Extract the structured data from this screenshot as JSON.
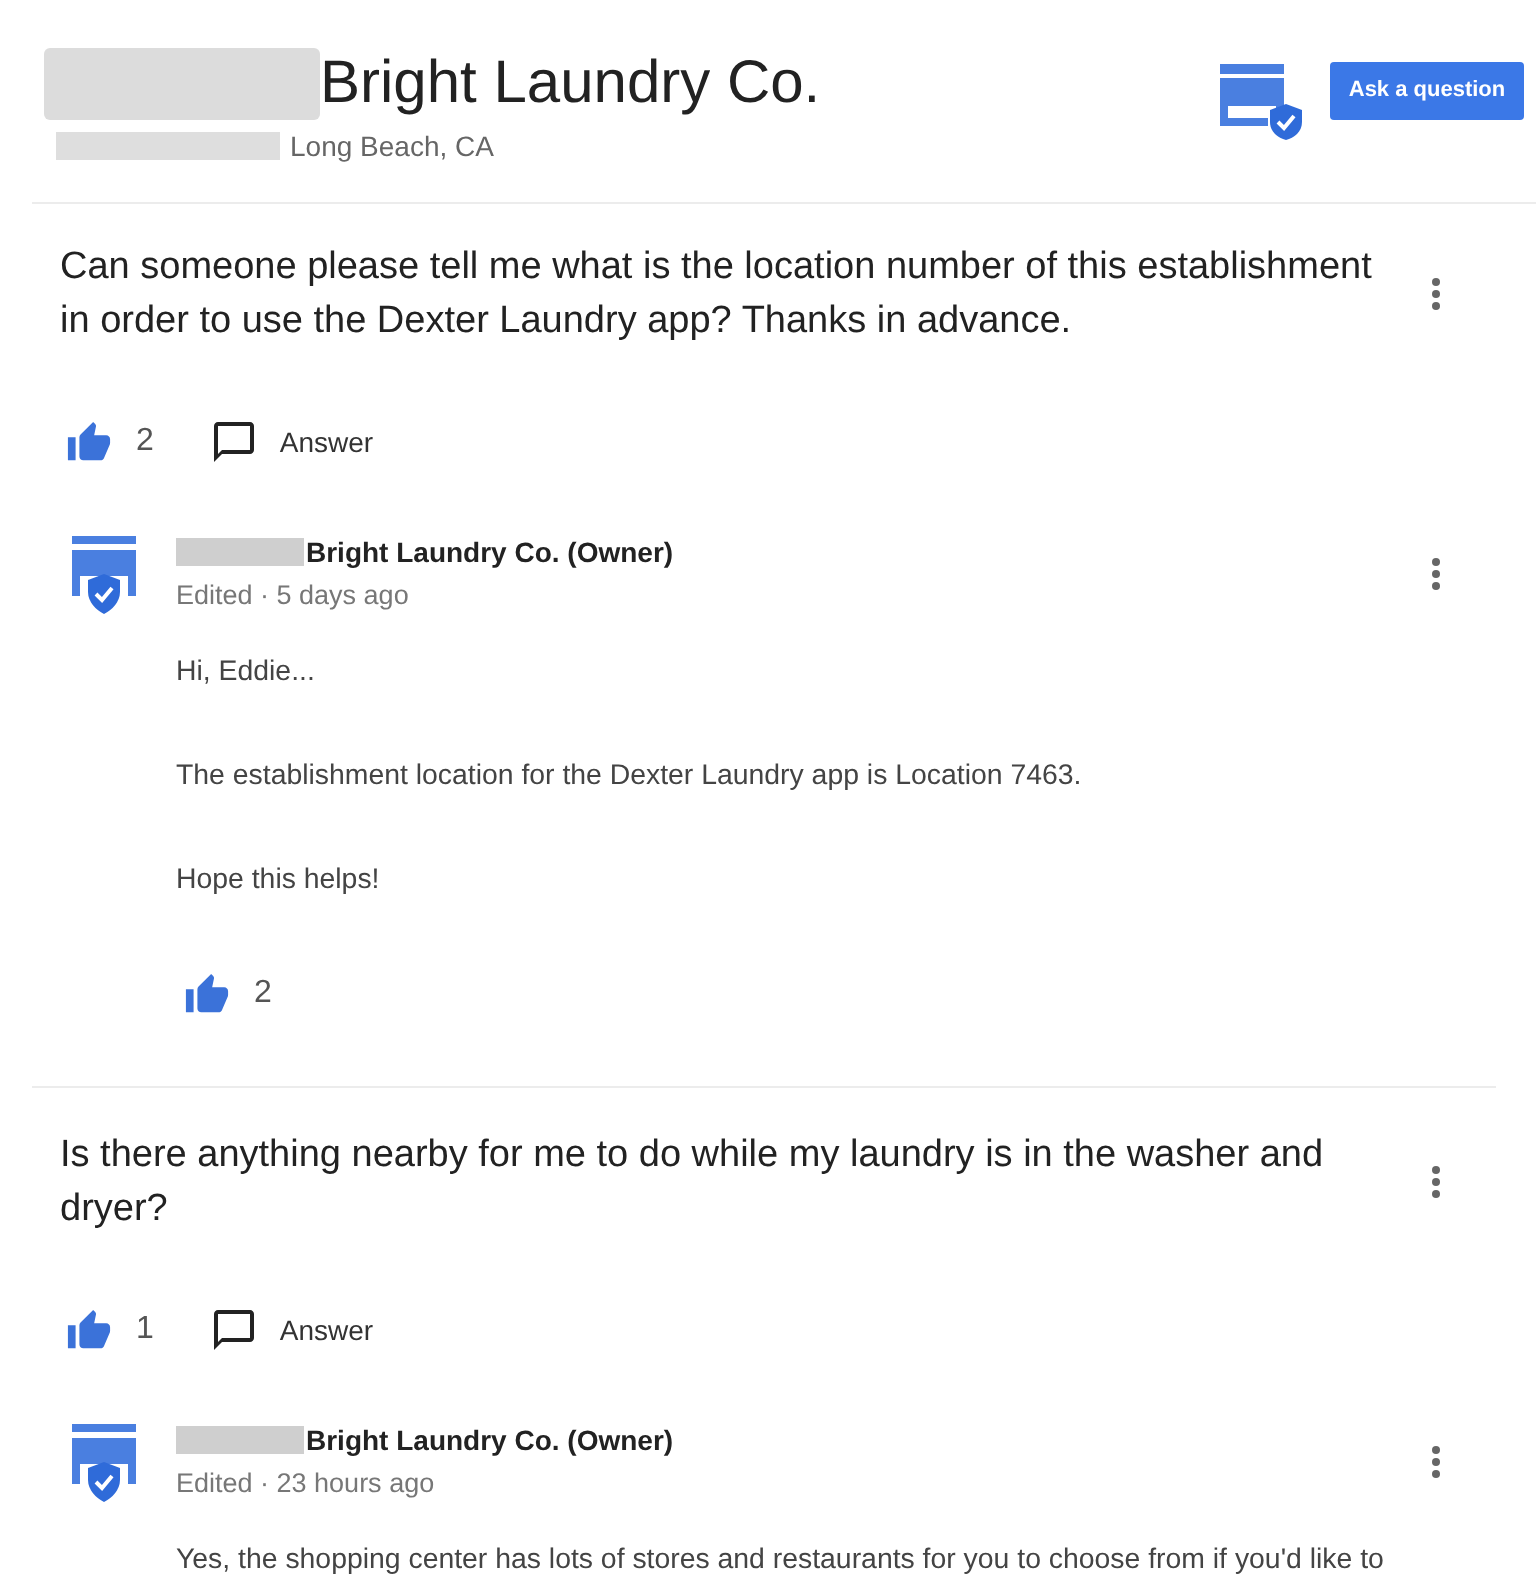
{
  "business": {
    "name": "Bright Laundry Co.",
    "location": "Long Beach, CA",
    "ask_button": "Ask a question"
  },
  "questions": [
    {
      "text": "Can someone please tell me what is the location number of this establishment in order to use the Dexter Laundry app? Thanks in advance.",
      "likes": "2",
      "answer_label": "Answer",
      "answer": {
        "author": "Bright Laundry Co. (Owner)",
        "meta": "Edited · 5 days ago",
        "paragraphs": [
          "Hi, Eddie...",
          "The establishment location for the Dexter Laundry app is Location 7463.",
          "Hope this helps!"
        ],
        "likes": "2"
      }
    },
    {
      "text": "Is there anything nearby for me to do while my laundry is in the washer and dryer?",
      "likes": "1",
      "answer_label": "Answer",
      "answer": {
        "author": "Bright Laundry Co. (Owner)",
        "meta": "Edited · 23 hours ago",
        "paragraphs": [
          "Yes, the shopping center has lots of stores and restaurants for you to choose from if you'd like to"
        ]
      }
    }
  ]
}
